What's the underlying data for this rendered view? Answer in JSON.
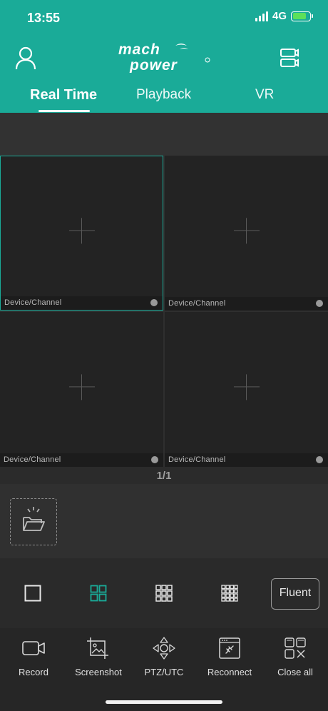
{
  "status_bar": {
    "time": "13:55",
    "network": "4G"
  },
  "header": {
    "logo_line1": "mach",
    "logo_line2": "power",
    "tabs": [
      {
        "label": "Real Time",
        "active": true
      },
      {
        "label": "Playback",
        "active": false
      },
      {
        "label": "VR",
        "active": false
      }
    ]
  },
  "grid": {
    "cells": [
      {
        "caption": "Device/Channel",
        "selected": true
      },
      {
        "caption": "Device/Channel",
        "selected": false
      },
      {
        "caption": "Device/Channel",
        "selected": false
      },
      {
        "caption": "Device/Channel",
        "selected": false
      }
    ],
    "page_indicator": "1/1"
  },
  "layout_bar": {
    "options": [
      "single-view-icon",
      "grid-4-icon",
      "grid-9-icon",
      "grid-16-icon"
    ],
    "selected_index": 1,
    "quality_label": "Fluent"
  },
  "toolbar": {
    "items": [
      {
        "label": "Record",
        "icon": "video-camera-icon"
      },
      {
        "label": "Screenshot",
        "icon": "screenshot-icon"
      },
      {
        "label": "PTZ/UTC",
        "icon": "ptz-icon"
      },
      {
        "label": "Reconnect",
        "icon": "reconnect-icon"
      },
      {
        "label": "Close all",
        "icon": "close-all-icon"
      }
    ]
  },
  "colors": {
    "accent": "#1aab98",
    "background": "#2b2b2b",
    "battery": "#5ce05a"
  }
}
